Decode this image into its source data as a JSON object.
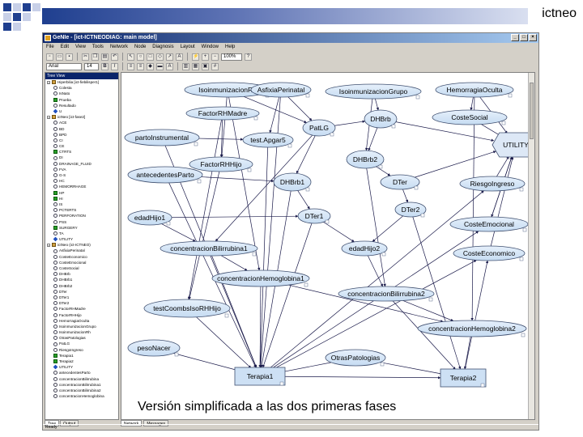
{
  "brand": "ictneo",
  "app": {
    "title": "GeNIe - [ict-ICTNEODIAG: main model]",
    "menu": [
      "File",
      "Edit",
      "View",
      "Tools",
      "Network",
      "Node",
      "Diagnosis",
      "Layout",
      "Window",
      "Help"
    ],
    "font_name": "Arial",
    "font_size": "14",
    "zoom_value": "100%",
    "status": "Ready",
    "tree_header": "Tree View",
    "tree_tabs": [
      "Tree",
      "Output"
    ],
    "canvas_tabs": [
      "Network",
      "Messages"
    ]
  },
  "tree": {
    "items": [
      {
        "label": "Hiperbilia [ict-fiebilisper1]",
        "icon": "group",
        "indent": 0
      },
      {
        "label": "Colesta",
        "icon": "oval",
        "indent": 1
      },
      {
        "label": "IsNato",
        "icon": "oval",
        "indent": 1
      },
      {
        "label": "Prueba",
        "icon": "square",
        "indent": 1
      },
      {
        "label": "Resultado",
        "icon": "oval",
        "indent": 1
      },
      {
        "label": "U",
        "icon": "diamond",
        "indent": 1
      },
      {
        "label": "ictNeo [ict-fase2]",
        "icon": "group",
        "indent": 0
      },
      {
        "label": "ACE",
        "icon": "oval",
        "indent": 1
      },
      {
        "label": "BD",
        "icon": "oval",
        "indent": 1
      },
      {
        "label": "BPD",
        "icon": "oval",
        "indent": 1
      },
      {
        "label": "CI",
        "icon": "oval",
        "indent": 1
      },
      {
        "label": "CE",
        "icon": "oval",
        "indent": 1
      },
      {
        "label": "CTRTS",
        "icon": "square",
        "indent": 1
      },
      {
        "label": "DI",
        "icon": "oval",
        "indent": 1
      },
      {
        "label": "DRAINAGE_FLUID",
        "icon": "oval",
        "indent": 1
      },
      {
        "label": "FVA",
        "icon": "oval",
        "indent": 1
      },
      {
        "label": "G-S",
        "icon": "oval",
        "indent": 1
      },
      {
        "label": "HC",
        "icon": "oval",
        "indent": 1
      },
      {
        "label": "HEMORRHAGE",
        "icon": "oval",
        "indent": 1
      },
      {
        "label": "HP",
        "icon": "square",
        "indent": 1
      },
      {
        "label": "HI",
        "icon": "square",
        "indent": 1
      },
      {
        "label": "IS",
        "icon": "oval",
        "indent": 1
      },
      {
        "label": "PCTERTS",
        "icon": "oval",
        "indent": 1
      },
      {
        "label": "PERFORATION",
        "icon": "oval",
        "indent": 1
      },
      {
        "label": "PSS",
        "icon": "oval",
        "indent": 1
      },
      {
        "label": "SURGERY",
        "icon": "square",
        "indent": 1
      },
      {
        "label": "TA",
        "icon": "oval",
        "indent": 1
      },
      {
        "label": "UTILITY",
        "icon": "diamond",
        "indent": 1
      },
      {
        "label": "ictNeo (ict-ICTNEO)",
        "icon": "group",
        "indent": 0
      },
      {
        "label": "AsfixiaPerinatal",
        "icon": "oval",
        "indent": 1
      },
      {
        "label": "CosteEconomico",
        "icon": "oval",
        "indent": 1
      },
      {
        "label": "CosteEmocional",
        "icon": "oval",
        "indent": 1
      },
      {
        "label": "CosteSocial",
        "icon": "oval",
        "indent": 1
      },
      {
        "label": "DHBrb",
        "icon": "oval",
        "indent": 1
      },
      {
        "label": "DHBrb1",
        "icon": "oval",
        "indent": 1
      },
      {
        "label": "DHBrb2",
        "icon": "oval",
        "indent": 1
      },
      {
        "label": "DTer",
        "icon": "oval",
        "indent": 1
      },
      {
        "label": "DTer1",
        "icon": "oval",
        "indent": 1
      },
      {
        "label": "DTer2",
        "icon": "oval",
        "indent": 1
      },
      {
        "label": "FactorRHMadre",
        "icon": "oval",
        "indent": 1
      },
      {
        "label": "FactorRHHijo",
        "icon": "oval",
        "indent": 1
      },
      {
        "label": "HemorragiaOculta",
        "icon": "oval",
        "indent": 1
      },
      {
        "label": "IsoinmunizacionGrupo",
        "icon": "oval",
        "indent": 1
      },
      {
        "label": "IsoinmunizacionRh",
        "icon": "oval",
        "indent": 1
      },
      {
        "label": "OtrasPatologias",
        "icon": "oval",
        "indent": 1
      },
      {
        "label": "PatLG",
        "icon": "oval",
        "indent": 1
      },
      {
        "label": "RiesgoIngreso",
        "icon": "oval",
        "indent": 1
      },
      {
        "label": "Terapia1",
        "icon": "square",
        "indent": 1
      },
      {
        "label": "Terapia2",
        "icon": "square",
        "indent": 1
      },
      {
        "label": "UTILITY",
        "icon": "diamond",
        "indent": 1
      },
      {
        "label": "antecedentesParto",
        "icon": "oval",
        "indent": 1
      },
      {
        "label": "concentracionBilirrubina",
        "icon": "oval",
        "indent": 1
      },
      {
        "label": "concentracionBilirrubina1",
        "icon": "oval",
        "indent": 1
      },
      {
        "label": "concentracionBilirrubina2",
        "icon": "oval",
        "indent": 1
      },
      {
        "label": "concentracionHemoglobina",
        "icon": "oval",
        "indent": 1
      }
    ]
  },
  "network": {
    "nodes": [
      {
        "id": "n1",
        "label": "IsoinmunizacionRh",
        "shape": "oval"
      },
      {
        "id": "n2",
        "label": "AsfixiaPerinatal",
        "shape": "oval"
      },
      {
        "id": "n3",
        "label": "IsoinmunizacionGrupo",
        "shape": "oval"
      },
      {
        "id": "n4",
        "label": "HemorragiaOculta",
        "shape": "oval"
      },
      {
        "id": "n5",
        "label": "FactorRHMadre",
        "shape": "oval"
      },
      {
        "id": "n6",
        "label": "PatLG",
        "shape": "oval"
      },
      {
        "id": "n7",
        "label": "DHBrb",
        "shape": "oval"
      },
      {
        "id": "n8",
        "label": "CosteSocial",
        "shape": "oval"
      },
      {
        "id": "n9",
        "label": "partoInstrumental",
        "shape": "oval"
      },
      {
        "id": "n10",
        "label": "test.Apgar5",
        "shape": "oval"
      },
      {
        "id": "n11",
        "label": "UTILITY",
        "shape": "hex"
      },
      {
        "id": "n12",
        "label": "FactorRHHijo",
        "shape": "oval"
      },
      {
        "id": "n13",
        "label": "DHBrb2",
        "shape": "oval"
      },
      {
        "id": "n14",
        "label": "antecedentesParto",
        "shape": "oval"
      },
      {
        "id": "n15",
        "label": "DHBrb1",
        "shape": "oval"
      },
      {
        "id": "n16",
        "label": "DTer",
        "shape": "oval"
      },
      {
        "id": "n17",
        "label": "RiesgoIngreso",
        "shape": "oval"
      },
      {
        "id": "n18",
        "label": "DTer2",
        "shape": "oval"
      },
      {
        "id": "n19",
        "label": "edadHijo1",
        "shape": "oval"
      },
      {
        "id": "n20",
        "label": "DTer1",
        "shape": "oval"
      },
      {
        "id": "n21",
        "label": "CosteEmocional",
        "shape": "oval"
      },
      {
        "id": "n22",
        "label": "concentracionBilirrubina1",
        "shape": "oval"
      },
      {
        "id": "n23",
        "label": "edadHijo2",
        "shape": "oval"
      },
      {
        "id": "n24",
        "label": "CosteEconomico",
        "shape": "oval"
      },
      {
        "id": "n25",
        "label": "concentracionHemoglobina1",
        "shape": "oval"
      },
      {
        "id": "n26",
        "label": "concentracionBilirrubina2",
        "shape": "oval"
      },
      {
        "id": "n27",
        "label": "testCoombsIsoRHHijo",
        "shape": "oval"
      },
      {
        "id": "n28",
        "label": "concentracionHemoglobina2",
        "shape": "oval"
      },
      {
        "id": "n29",
        "label": "pesoNacer",
        "shape": "oval"
      },
      {
        "id": "n30",
        "label": "OtrasPatologias",
        "shape": "oval"
      },
      {
        "id": "n31",
        "label": "Terapia1",
        "shape": "rect"
      },
      {
        "id": "n32",
        "label": "Terapia2",
        "shape": "rect"
      }
    ],
    "edges": [
      [
        "n1",
        "n6"
      ],
      [
        "n1",
        "n12"
      ],
      [
        "n1",
        "n25"
      ],
      [
        "n2",
        "n6"
      ],
      [
        "n2",
        "n10"
      ],
      [
        "n2",
        "n31"
      ],
      [
        "n3",
        "n7"
      ],
      [
        "n3",
        "n13"
      ],
      [
        "n4",
        "n8"
      ],
      [
        "n4",
        "n28"
      ],
      [
        "n4",
        "n11"
      ],
      [
        "n5",
        "n12"
      ],
      [
        "n5",
        "n27"
      ],
      [
        "n6",
        "n15"
      ],
      [
        "n6",
        "n22"
      ],
      [
        "n6",
        "n7"
      ],
      [
        "n7",
        "n11"
      ],
      [
        "n7",
        "n13"
      ],
      [
        "n8",
        "n11"
      ],
      [
        "n9",
        "n10"
      ],
      [
        "n9",
        "n31"
      ],
      [
        "n10",
        "n31"
      ],
      [
        "n12",
        "n27"
      ],
      [
        "n13",
        "n16"
      ],
      [
        "n13",
        "n26"
      ],
      [
        "n14",
        "n15"
      ],
      [
        "n14",
        "n31"
      ],
      [
        "n15",
        "n20"
      ],
      [
        "n15",
        "n31"
      ],
      [
        "n16",
        "n18"
      ],
      [
        "n16",
        "n11"
      ],
      [
        "n17",
        "n11"
      ],
      [
        "n18",
        "n32"
      ],
      [
        "n18",
        "n23"
      ],
      [
        "n19",
        "n22"
      ],
      [
        "n19",
        "n20"
      ],
      [
        "n20",
        "n31"
      ],
      [
        "n20",
        "n23"
      ],
      [
        "n21",
        "n11"
      ],
      [
        "n22",
        "n25"
      ],
      [
        "n22",
        "n31"
      ],
      [
        "n23",
        "n26"
      ],
      [
        "n24",
        "n11"
      ],
      [
        "n25",
        "n31"
      ],
      [
        "n25",
        "n28"
      ],
      [
        "n26",
        "n28"
      ],
      [
        "n26",
        "n32"
      ],
      [
        "n27",
        "n31"
      ],
      [
        "n28",
        "n32"
      ],
      [
        "n29",
        "n31"
      ],
      [
        "n30",
        "n31"
      ],
      [
        "n30",
        "n32"
      ],
      [
        "n31",
        "n21"
      ],
      [
        "n31",
        "n24"
      ],
      [
        "n31",
        "n17"
      ],
      [
        "n32",
        "n24"
      ],
      [
        "n31",
        "n32"
      ],
      [
        "n11",
        "n21"
      ]
    ]
  },
  "caption": "Versión simplificada a las dos primeras fases"
}
